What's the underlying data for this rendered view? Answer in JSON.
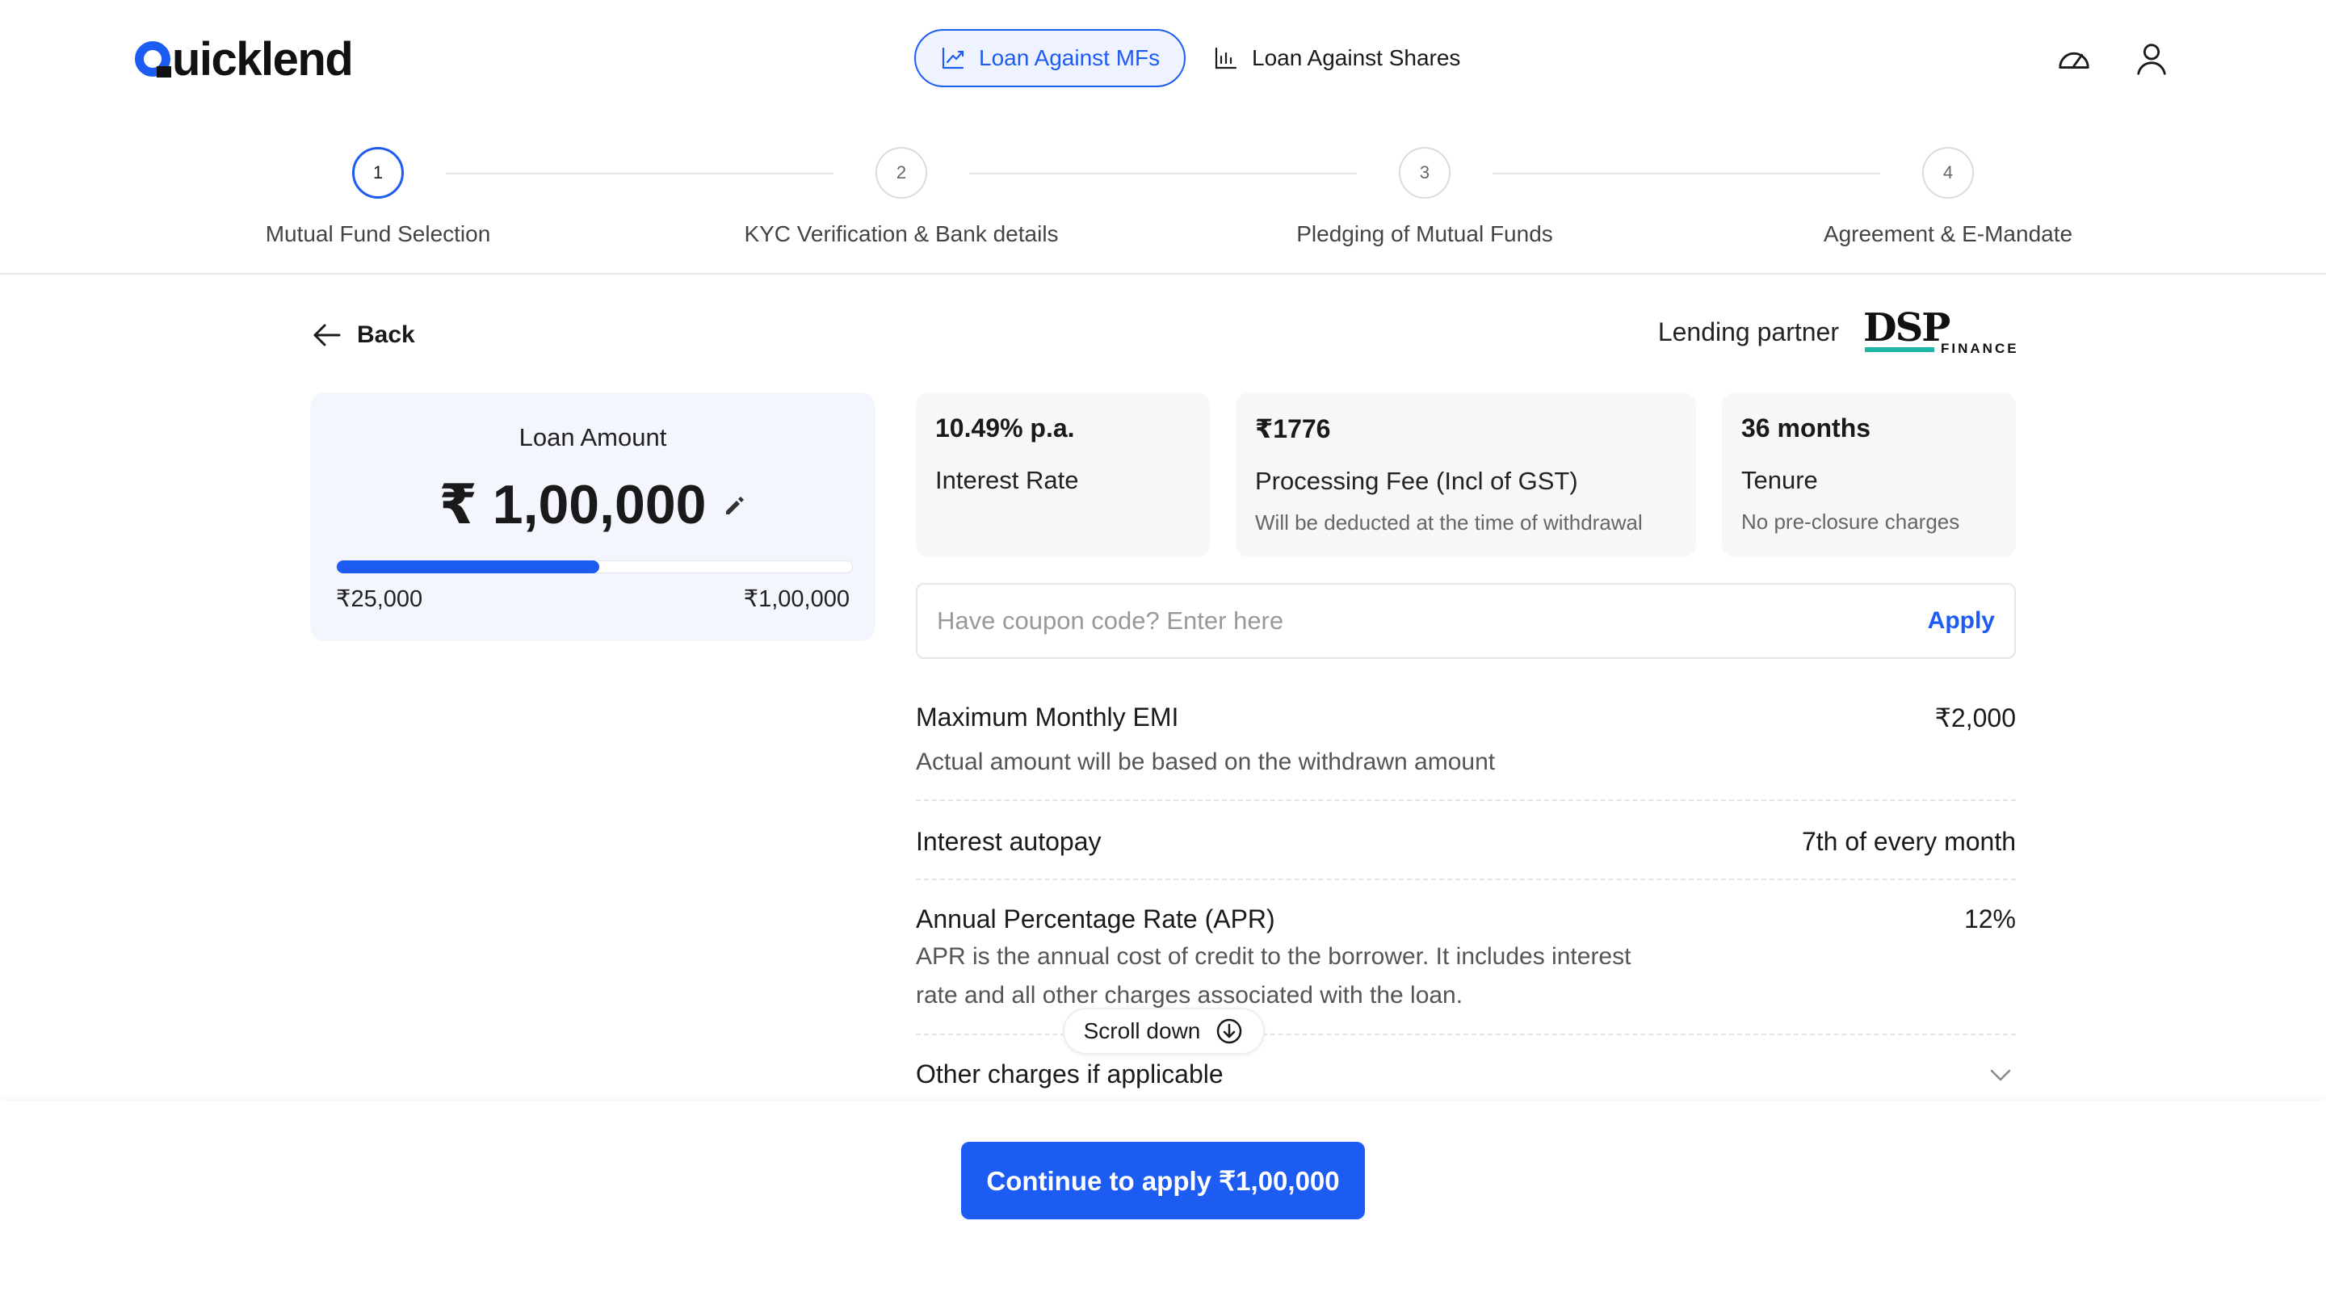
{
  "header": {
    "logo_text": "uicklend",
    "tabs": [
      {
        "label": "Loan Against MFs",
        "active": true
      },
      {
        "label": "Loan Against Shares",
        "active": false
      }
    ]
  },
  "stepper": {
    "steps": [
      {
        "number": "1",
        "label": "Mutual Fund Selection"
      },
      {
        "number": "2",
        "label": "KYC Verification & Bank details"
      },
      {
        "number": "3",
        "label": "Pledging of Mutual Funds"
      },
      {
        "number": "4",
        "label": "Agreement & E-Mandate"
      }
    ],
    "active_step": 1
  },
  "back_label": "Back",
  "partner": {
    "label": "Lending partner",
    "logo_big": "DSP",
    "logo_small": "FINANCE"
  },
  "loan": {
    "title": "Loan Amount",
    "amount": "₹ 1,00,000",
    "min": "₹25,000",
    "max": "₹1,00,000",
    "slider_fill_percent": 51
  },
  "tiles": [
    {
      "value": "10.49% p.a.",
      "label": "Interest Rate",
      "sub": ""
    },
    {
      "value": "₹1776",
      "label": "Processing Fee (Incl of GST)",
      "sub": "Will be deducted at the time of withdrawal"
    },
    {
      "value": "36 months",
      "label": "Tenure",
      "sub": "No pre-closure charges"
    }
  ],
  "coupon": {
    "placeholder": "Have coupon code? Enter here",
    "value": "",
    "apply_label": "Apply"
  },
  "details": [
    {
      "label": "Maximum Monthly EMI",
      "value": "₹2,000",
      "desc": "Actual amount will be based on the withdrawn amount"
    },
    {
      "label": "Interest autopay",
      "value": "7th of every month",
      "desc": ""
    },
    {
      "label": "Annual Percentage Rate (APR)",
      "value": "12%",
      "desc_line1": "APR is the annual cost of credit to the borrower. It includes interest",
      "desc_line2": "rate and all other charges associated with the loan."
    },
    {
      "label": "Other charges if applicable",
      "value": ""
    }
  ],
  "scroll_label": "Scroll down",
  "cta_label": "Continue to apply ₹1,00,000",
  "colors": {
    "accent": "#1d5cf2",
    "partner_bar": "#1fb5a6"
  }
}
